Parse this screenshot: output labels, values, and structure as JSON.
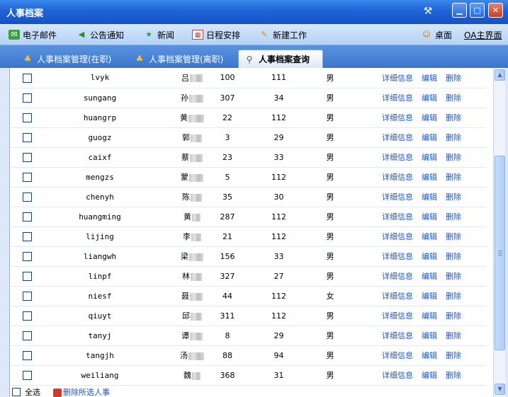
{
  "window": {
    "title": "人事档案",
    "controls": [
      "minimize",
      "maximize",
      "close"
    ]
  },
  "toolbar": {
    "items": [
      {
        "label": "电子邮件",
        "icon": "email-icon"
      },
      {
        "label": "公告通知",
        "icon": "megaphone-icon"
      },
      {
        "label": "新闻",
        "icon": "star-icon"
      },
      {
        "label": "日程安排",
        "icon": "calendar-icon"
      },
      {
        "label": "新建工作",
        "icon": "new-work-icon"
      }
    ],
    "right": [
      {
        "label": "桌面",
        "icon": "desktop-people-icon"
      },
      {
        "label": "OA主界面"
      }
    ]
  },
  "tabs": [
    {
      "label": "人事档案管理(在职)",
      "active": false
    },
    {
      "label": "人事档案管理(离职)",
      "active": false
    },
    {
      "label": "人事档案查询",
      "active": true
    }
  ],
  "rows": [
    {
      "user": "lvyk",
      "name": "吕",
      "n1": "100",
      "n2": "111",
      "sex": "男"
    },
    {
      "user": "sungang",
      "name": "孙",
      "n1": "307",
      "n2": "34",
      "sex": "男"
    },
    {
      "user": "huangrp",
      "name": "黄",
      "n1": "22",
      "n2": "112",
      "sex": "男"
    },
    {
      "user": "guogz",
      "name": "郭",
      "n1": "3",
      "n2": "29",
      "sex": "男"
    },
    {
      "user": "caixf",
      "name": "蔡",
      "n1": "23",
      "n2": "33",
      "sex": "男"
    },
    {
      "user": "mengzs",
      "name": "蒙",
      "n1": "5",
      "n2": "112",
      "sex": "男"
    },
    {
      "user": "chenyh",
      "name": "陈",
      "n1": "35",
      "n2": "30",
      "sex": "男"
    },
    {
      "user": "huangming",
      "name": "黄",
      "n1": "287",
      "n2": "112",
      "sex": "男"
    },
    {
      "user": "lijing",
      "name": "李",
      "n1": "21",
      "n2": "112",
      "sex": "男"
    },
    {
      "user": "liangwh",
      "name": "梁",
      "n1": "156",
      "n2": "33",
      "sex": "男"
    },
    {
      "user": "linpf",
      "name": "林",
      "n1": "327",
      "n2": "27",
      "sex": "男"
    },
    {
      "user": "niesf",
      "name": "聂",
      "n1": "44",
      "n2": "112",
      "sex": "女"
    },
    {
      "user": "qiuyt",
      "name": "邱",
      "n1": "311",
      "n2": "112",
      "sex": "男"
    },
    {
      "user": "tanyj",
      "name": "谭",
      "n1": "8",
      "n2": "29",
      "sex": "男"
    },
    {
      "user": "tangjh",
      "name": "汤",
      "n1": "88",
      "n2": "94",
      "sex": "男"
    },
    {
      "user": "weiliang",
      "name": "魏",
      "n1": "368",
      "n2": "31",
      "sex": "男"
    }
  ],
  "actions": {
    "detail": "详细信息",
    "edit": "编辑",
    "delete": "删除"
  },
  "footer": {
    "select_all": "全选",
    "delete_selected": "删除所选人事"
  }
}
